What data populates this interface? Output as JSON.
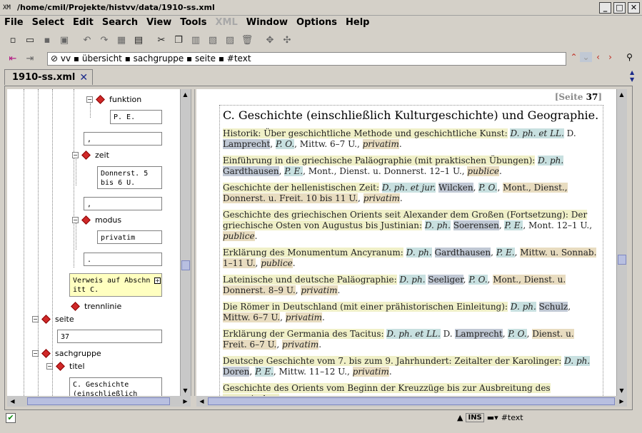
{
  "window": {
    "title": "/home/cmil/Projekte/histvv/data/1910-ss.xml",
    "app_icon": "XM"
  },
  "menu": [
    "File",
    "Select",
    "Edit",
    "Search",
    "View",
    "Tools",
    "XML",
    "Window",
    "Options",
    "Help"
  ],
  "address": {
    "path": " vv ▪ übersicht ▪ sachgruppe ▪ seite ▪ #text"
  },
  "tab": {
    "label": "1910-ss.xml",
    "close": "✕"
  },
  "tree": {
    "funktion": "funktion",
    "funktion_value": "P. E.",
    "comma1": ",",
    "zeit": "zeit",
    "zeit_value": "Donnerst. 5 bis 6 U.",
    "comma2": ",",
    "modus": "modus",
    "modus_value": "privatim",
    "period": ".",
    "verweis": "Verweis auf Abschn itt C.",
    "trennlinie": "trennlinie",
    "seite": "seite",
    "seite_value": "37",
    "sachgruppe": "sachgruppe",
    "titel": "titel",
    "titel_value": "C. Geschichte (einschließlich"
  },
  "document": {
    "page_label": "[Seite ",
    "page_number": "37",
    "page_label_end": "]",
    "heading": "C. Geschichte (einschließlich Kulturgeschichte) und Geographie."
  },
  "status": {
    "ins": "INS",
    "node": "#text",
    "check": "✔"
  }
}
